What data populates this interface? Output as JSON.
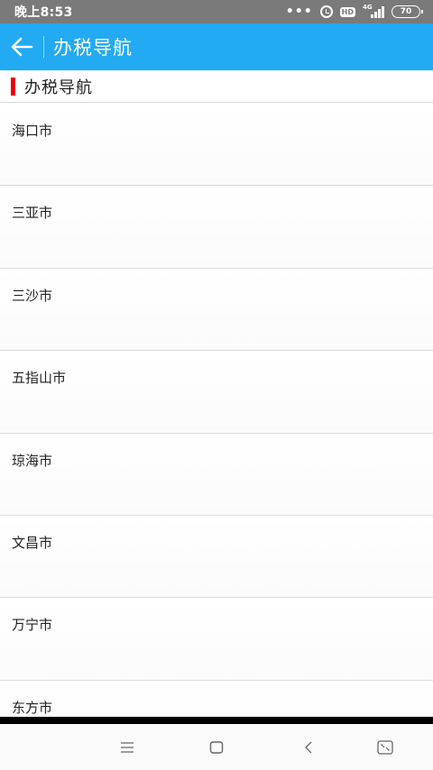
{
  "status_bar": {
    "time": "晚上8:53",
    "dots": "•••",
    "hd_label": "HD",
    "network": "4G",
    "battery": "70"
  },
  "app_bar": {
    "title": "办税导航",
    "back_icon": "arrow-left-icon"
  },
  "section": {
    "title": "办税导航",
    "marker_color": "#e60012"
  },
  "cities": [
    "海口市",
    "三亚市",
    "三沙市",
    "五指山市",
    "琼海市",
    "文昌市",
    "万宁市",
    "东方市"
  ],
  "nav_bar": {
    "buttons": [
      "menu-icon",
      "home-square-icon",
      "back-chevron-icon",
      "screen-expand-icon"
    ]
  },
  "colors": {
    "app_bar": "#22aaf2",
    "status_bar": "#7a7a7a"
  }
}
